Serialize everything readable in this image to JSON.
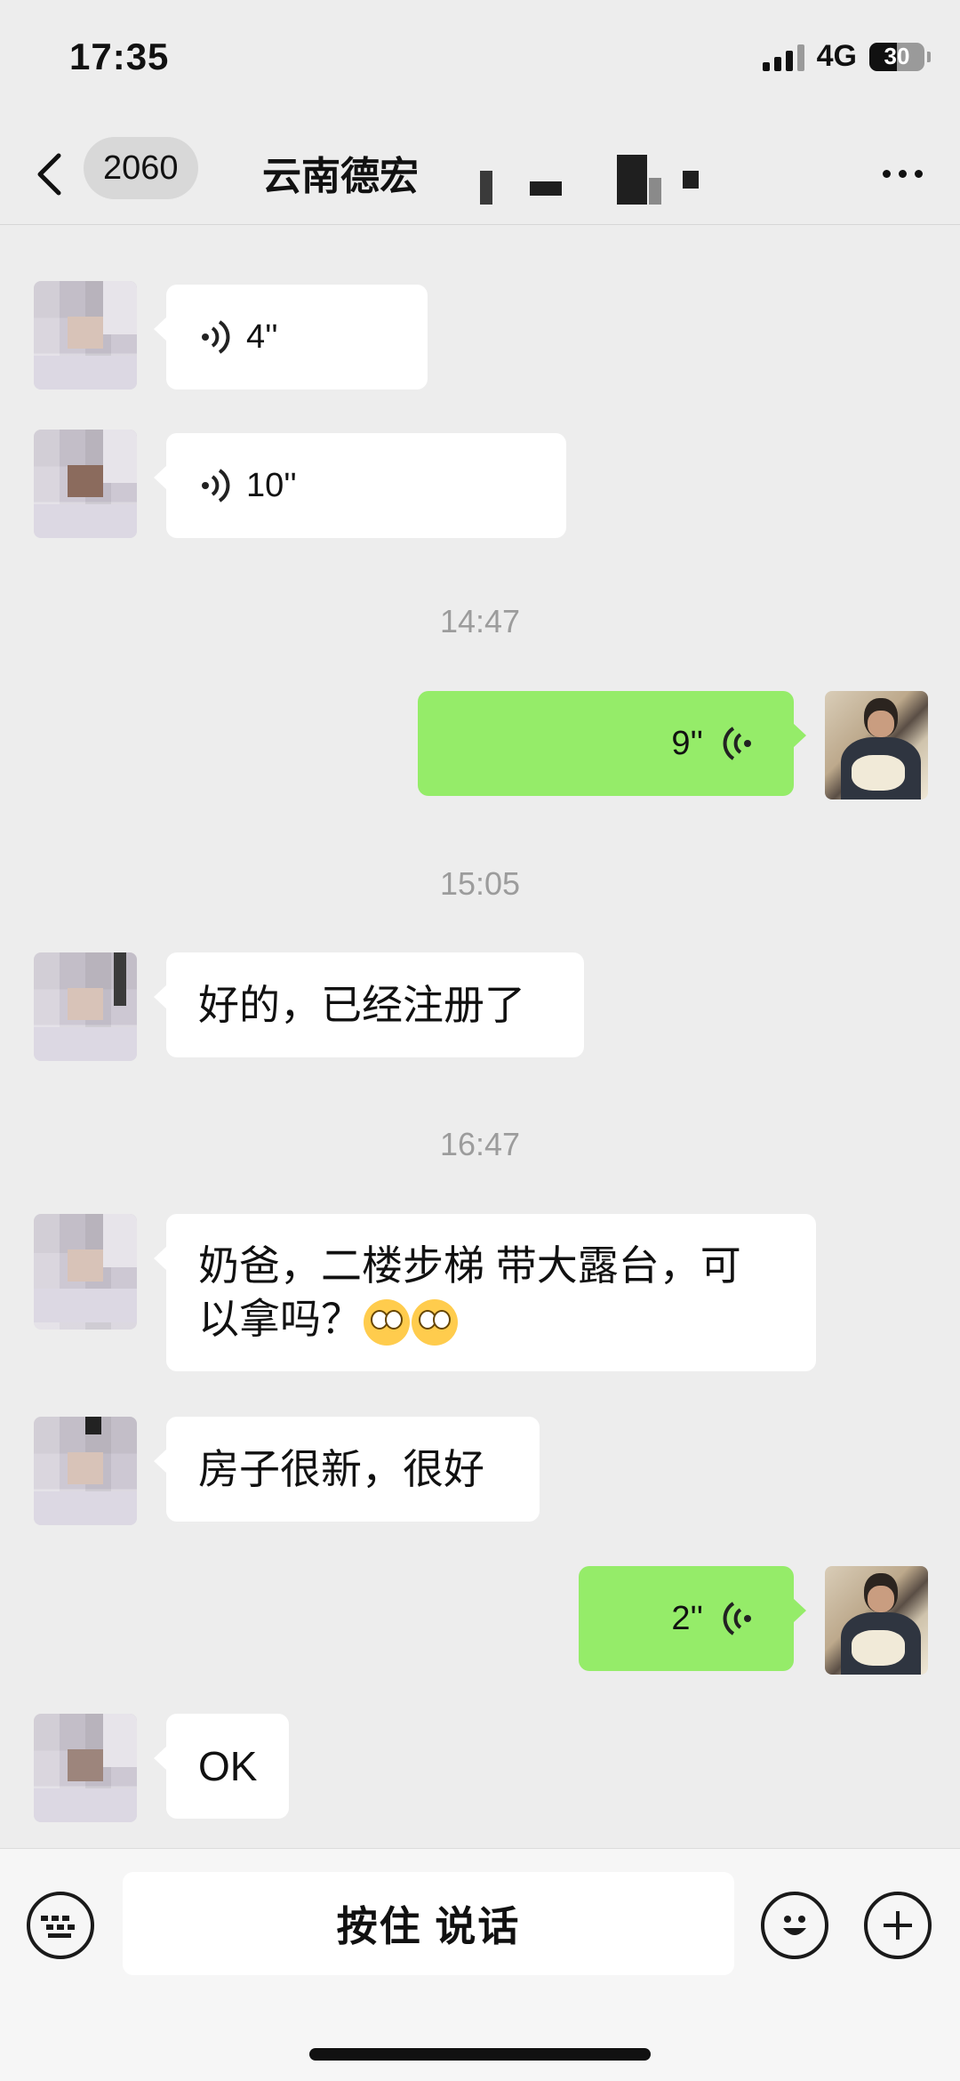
{
  "status_bar": {
    "time": "17:35",
    "network": "4G",
    "battery": "30"
  },
  "nav": {
    "back_badge": "2060",
    "title": "云南德宏"
  },
  "messages": [
    {
      "type": "voice",
      "side": "in",
      "duration": "4''"
    },
    {
      "type": "voice",
      "side": "in",
      "duration": "10''"
    },
    {
      "type": "timestamp",
      "text": "14:47"
    },
    {
      "type": "voice",
      "side": "out",
      "duration": "9''"
    },
    {
      "type": "timestamp",
      "text": "15:05"
    },
    {
      "type": "text",
      "side": "in",
      "text": "好的，已经注册了"
    },
    {
      "type": "timestamp",
      "text": "16:47"
    },
    {
      "type": "text",
      "side": "in",
      "line1": "奶爸，二楼步梯 带大露台，可",
      "line2": "以拿吗？",
      "emoji": "flushed-face-emoji"
    },
    {
      "type": "text",
      "side": "in",
      "text": "房子很新，很好"
    },
    {
      "type": "voice",
      "side": "out",
      "duration": "2''"
    },
    {
      "type": "text",
      "side": "in",
      "text": "OK"
    }
  ],
  "input_bar": {
    "talk_label": "按住 说话"
  },
  "icons": {
    "back": "chevron-left-icon",
    "more": "more-dots-icon",
    "voice": "voice-wave-icon",
    "keyboard": "keyboard-icon",
    "emoji": "smiley-icon",
    "plus": "plus-icon"
  },
  "colors": {
    "outgoing_bubble": "#95ec69",
    "incoming_bubble": "#ffffff",
    "background": "#ededed"
  }
}
